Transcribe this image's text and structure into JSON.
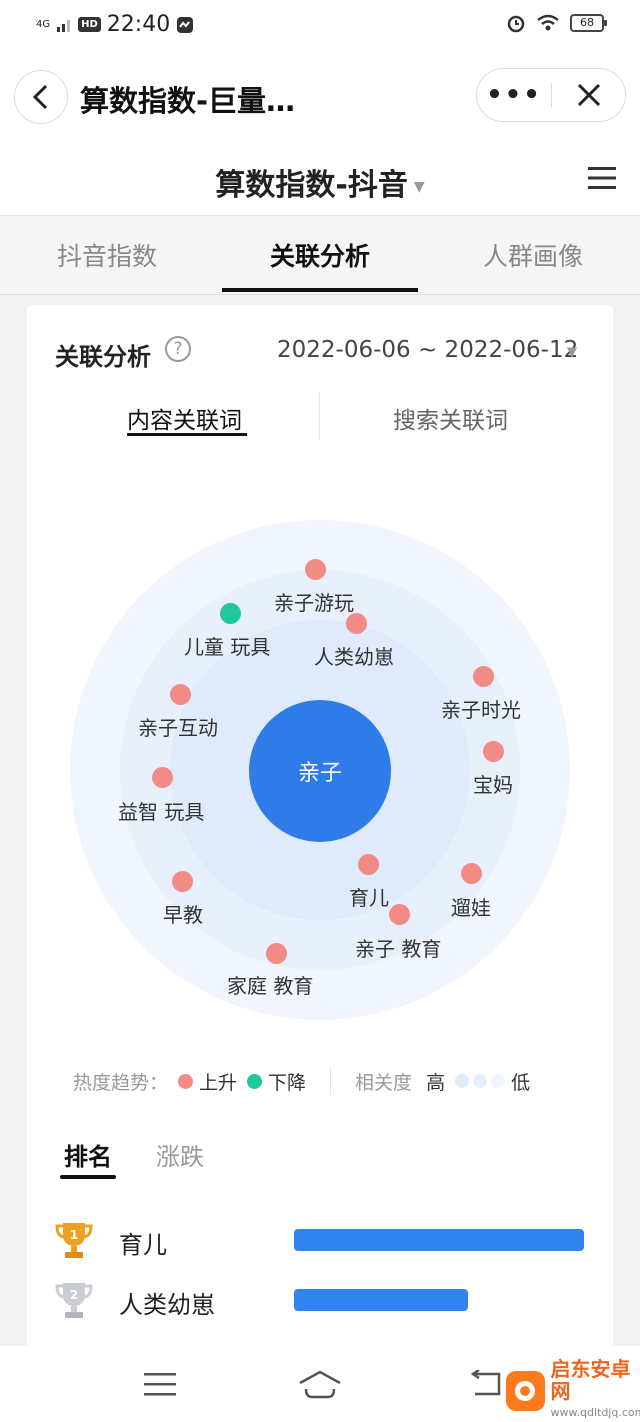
{
  "status_bar": {
    "network": "4G",
    "hd": "HD",
    "time": "22:40",
    "battery": "68"
  },
  "title_bar": {
    "title": "算数指数-巨量…",
    "more_label": "•••"
  },
  "page_header": {
    "title": "算数指数-抖音"
  },
  "tabs": [
    {
      "label": "抖音指数",
      "active": false
    },
    {
      "label": "关联分析",
      "active": true
    },
    {
      "label": "人群画像",
      "active": false
    }
  ],
  "section": {
    "title": "关联分析",
    "help": "?",
    "date_range": "2022-06-06 ~ 2022-06-12"
  },
  "sub_tabs": [
    {
      "label": "内容关联词",
      "active": true
    },
    {
      "label": "搜索关联词",
      "active": false
    }
  ],
  "bubble_chart": {
    "center": "亲子",
    "words": [
      {
        "label": "亲子游玩",
        "trend": "up"
      },
      {
        "label": "儿童 玩具",
        "trend": "down"
      },
      {
        "label": "人类幼崽",
        "trend": "up"
      },
      {
        "label": "亲子时光",
        "trend": "up"
      },
      {
        "label": "亲子互动",
        "trend": "up"
      },
      {
        "label": "宝妈",
        "trend": "up"
      },
      {
        "label": "益智 玩具",
        "trend": "up"
      },
      {
        "label": "育儿",
        "trend": "up"
      },
      {
        "label": "遛娃",
        "trend": "up"
      },
      {
        "label": "早教",
        "trend": "up"
      },
      {
        "label": "亲子 教育",
        "trend": "up"
      },
      {
        "label": "家庭  教育",
        "trend": "up"
      }
    ]
  },
  "legend": {
    "trend_label": "热度趋势：",
    "up_label": "上升",
    "down_label": "下降",
    "relevance_label": "相关度",
    "high_label": "高",
    "low_label": "低",
    "up_color": "#f28a86",
    "down_color": "#1fc89a"
  },
  "rank_tabs": [
    {
      "label": "排名",
      "active": true
    },
    {
      "label": "涨跌",
      "active": false
    }
  ],
  "ranking": [
    {
      "rank": 1,
      "word": "育儿",
      "value": 1.0
    },
    {
      "rank": 2,
      "word": "人类幼崽",
      "value": 0.6
    }
  ],
  "colors": {
    "accent_blue": "#2f7be8",
    "bar_blue": "#2f84ef"
  },
  "watermark": {
    "name": "启东安卓网",
    "url": "www.qdltdjq.com"
  }
}
